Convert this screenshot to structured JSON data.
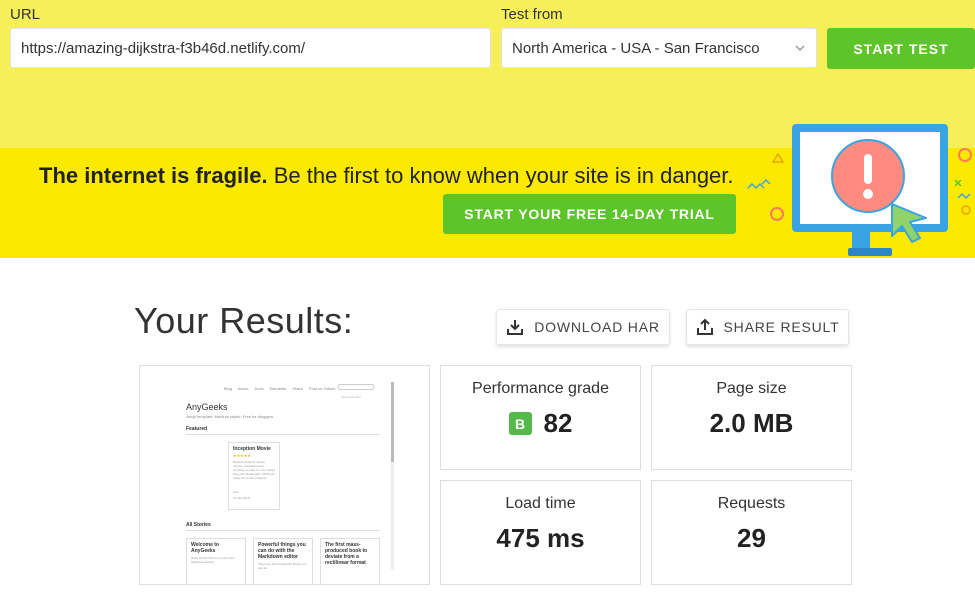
{
  "form": {
    "url_label": "URL",
    "url_value": "https://amazing-dijkstra-f3b46d.netlify.com/",
    "test_from_label": "Test from",
    "test_from_value": "North America - USA - San Francisco",
    "start_button": "START TEST"
  },
  "banner": {
    "headline_bold": "The internet is fragile.",
    "headline_rest": " Be the first to know when your site is in danger.",
    "trial_button": "START YOUR FREE 14-DAY TRIAL"
  },
  "results": {
    "title": "Your Results:",
    "download_har": "DOWNLOAD HAR",
    "share_result": "SHARE RESULT",
    "metrics": {
      "performance": {
        "label": "Performance grade",
        "grade": "B",
        "value": "82"
      },
      "page_size": {
        "label": "Page size",
        "value": "2.0 MB"
      },
      "load_time": {
        "label": "Load time",
        "value": "475 ms"
      },
      "requests": {
        "label": "Requests",
        "value": "29"
      }
    }
  },
  "thumbnail": {
    "nav": [
      "Blog",
      "About",
      "Docs",
      "Elements",
      "Share",
      "Post on Github"
    ],
    "search_placeholder": "Type and enter",
    "site_title": "AnyGeeks",
    "tagline": "Jekyll template. Medium styled. Free for bloggers.",
    "featured_label": "Featured",
    "featured_post": {
      "title": "Inception Movie",
      "excerpt": "Review products, books, movies, restaurant and anything you like on your Jekyll blog with Mediumish! JSON-LD ready for review property.",
      "author": "john",
      "date": "12 Jan 2018"
    },
    "all_stories_label": "All Stories",
    "stories": [
      {
        "title": "Welcome to AnyGeeks",
        "excerpt": "Hello World! This is my first post. Welcome aboard."
      },
      {
        "title": "Powerful things you can do with the Markdown editor",
        "excerpt": "There are lots of powerful things you can do."
      },
      {
        "title": "The first mass-produced book to deviate from a rectilinear format",
        "excerpt": ""
      }
    ]
  },
  "colors": {
    "top_yellow": "#f6ef58",
    "banner_yellow": "#fbea00",
    "green": "#5dc42a",
    "grade_green": "#54b84a"
  }
}
